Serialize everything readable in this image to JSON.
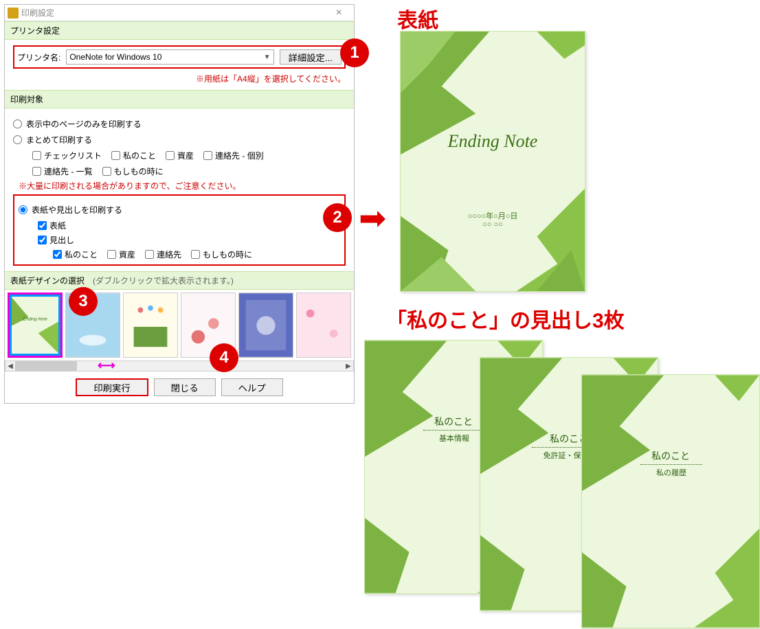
{
  "dialog": {
    "title": "印刷設定",
    "close": "×"
  },
  "printer": {
    "section": "プリンタ設定",
    "label": "プリンタ名:",
    "selected": "OneNote for Windows 10",
    "detail": "詳細設定...",
    "paper_note": "※用紙は「A4縦」を選択してください。"
  },
  "target": {
    "section": "印刷対象",
    "opt1": "表示中のページのみを印刷する",
    "opt2": "まとめて印刷する",
    "checks2": [
      "チェックリスト",
      "私のこと",
      "資産",
      "連絡先 - 個別",
      "連絡先 - 一覧",
      "もしもの時に"
    ],
    "warn2": "※大量に印刷される場合がありますので、ご注意ください。",
    "opt3": "表紙や見出しを印刷する",
    "chk3a": "表紙",
    "chk3b": "見出し",
    "checks3": [
      "私のこと",
      "資産",
      "連絡先",
      "もしもの時に"
    ]
  },
  "design": {
    "section": "表紙デザインの選択",
    "hint": "(ダブルクリックで拡大表示されます。)"
  },
  "buttons": {
    "print": "印刷実行",
    "close": "閉じる",
    "help": "ヘルプ"
  },
  "badges": [
    "1",
    "2",
    "3",
    "4"
  ],
  "annot": {
    "cover": "表紙",
    "headings": "「私のこと」の見出し3枚"
  },
  "preview": {
    "cover_title": "Ending Note",
    "cover_date": "○○○○年○月○日",
    "cover_dots": "○○  ○○",
    "h1": "私のこと",
    "h1s": "基本情報",
    "h2": "私のこと",
    "h2s": "免許証・保険証",
    "h3": "私のこと",
    "h3s": "私の履歴"
  }
}
